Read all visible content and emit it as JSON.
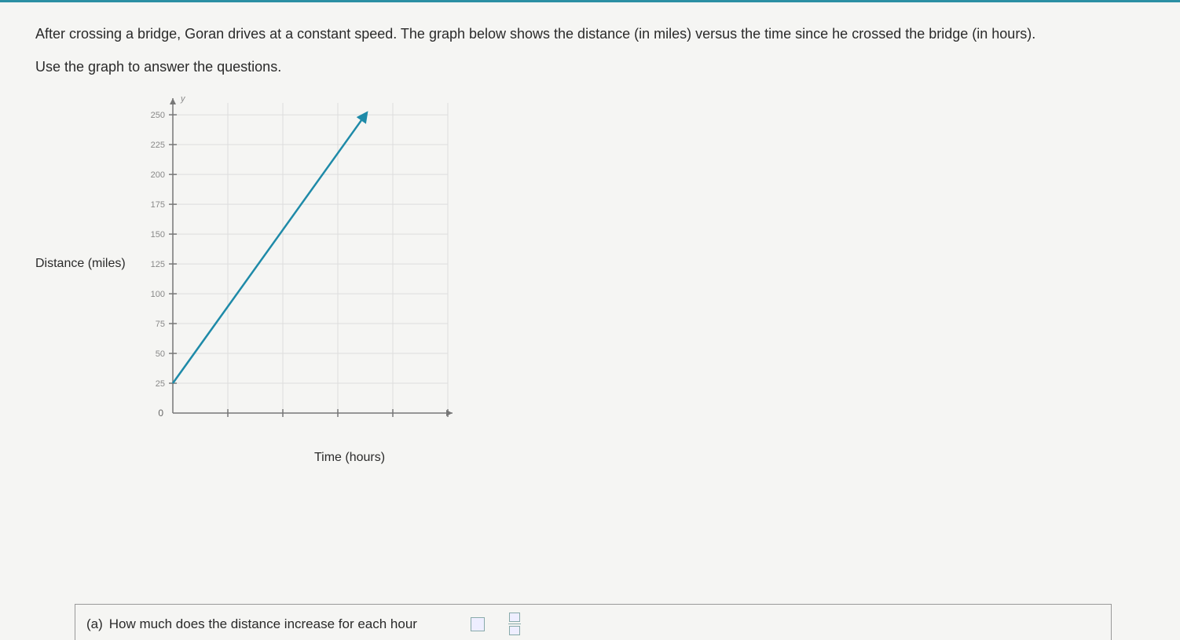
{
  "prompt": "After crossing a bridge, Goran drives at a constant speed. The graph below shows the distance (in miles) versus the time since he crossed the bridge (in hours).",
  "instruction": "Use the graph to answer the questions.",
  "chart_data": {
    "type": "line",
    "title": "",
    "xlabel": "Time (hours)",
    "ylabel": "Distance (miles)",
    "xlim": [
      0,
      5
    ],
    "ylim": [
      0,
      260
    ],
    "y_ticks": [
      0,
      25,
      50,
      75,
      100,
      125,
      150,
      175,
      200,
      225,
      250
    ],
    "x_ticks": [
      0,
      1,
      2,
      3,
      4,
      5
    ],
    "x_label_origin": "0",
    "y_axis_symbol": "y",
    "series": [
      {
        "name": "distance",
        "x": [
          0,
          3.5
        ],
        "values": [
          25,
          250
        ],
        "color": "#1e8aa8",
        "arrow_end": true
      }
    ],
    "grid": true
  },
  "question": {
    "label": "(a)",
    "text": "How much does the distance increase for each hour"
  }
}
